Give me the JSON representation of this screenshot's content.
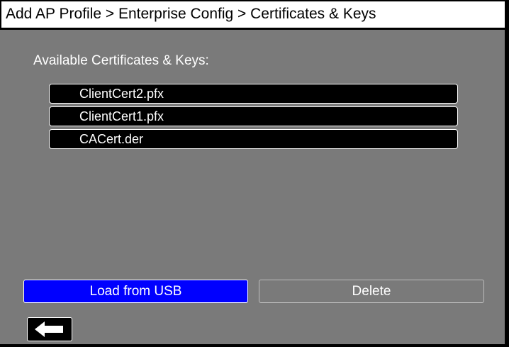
{
  "header": {
    "title": "Add AP Profile > Enterprise Config > Certificates & Keys"
  },
  "section": {
    "label": "Available Certificates & Keys:"
  },
  "certificates": [
    {
      "label": "ClientCert2.pfx"
    },
    {
      "label": "ClientCert1.pfx"
    },
    {
      "label": "CACert.der"
    }
  ],
  "actions": {
    "load_label": "Load from USB",
    "delete_label": "Delete"
  },
  "icons": {
    "back": "arrow-left-icon"
  },
  "colors": {
    "background": "#7a7a7a",
    "primary_button": "#0000ff",
    "list_item": "#000000",
    "text": "#ffffff"
  }
}
